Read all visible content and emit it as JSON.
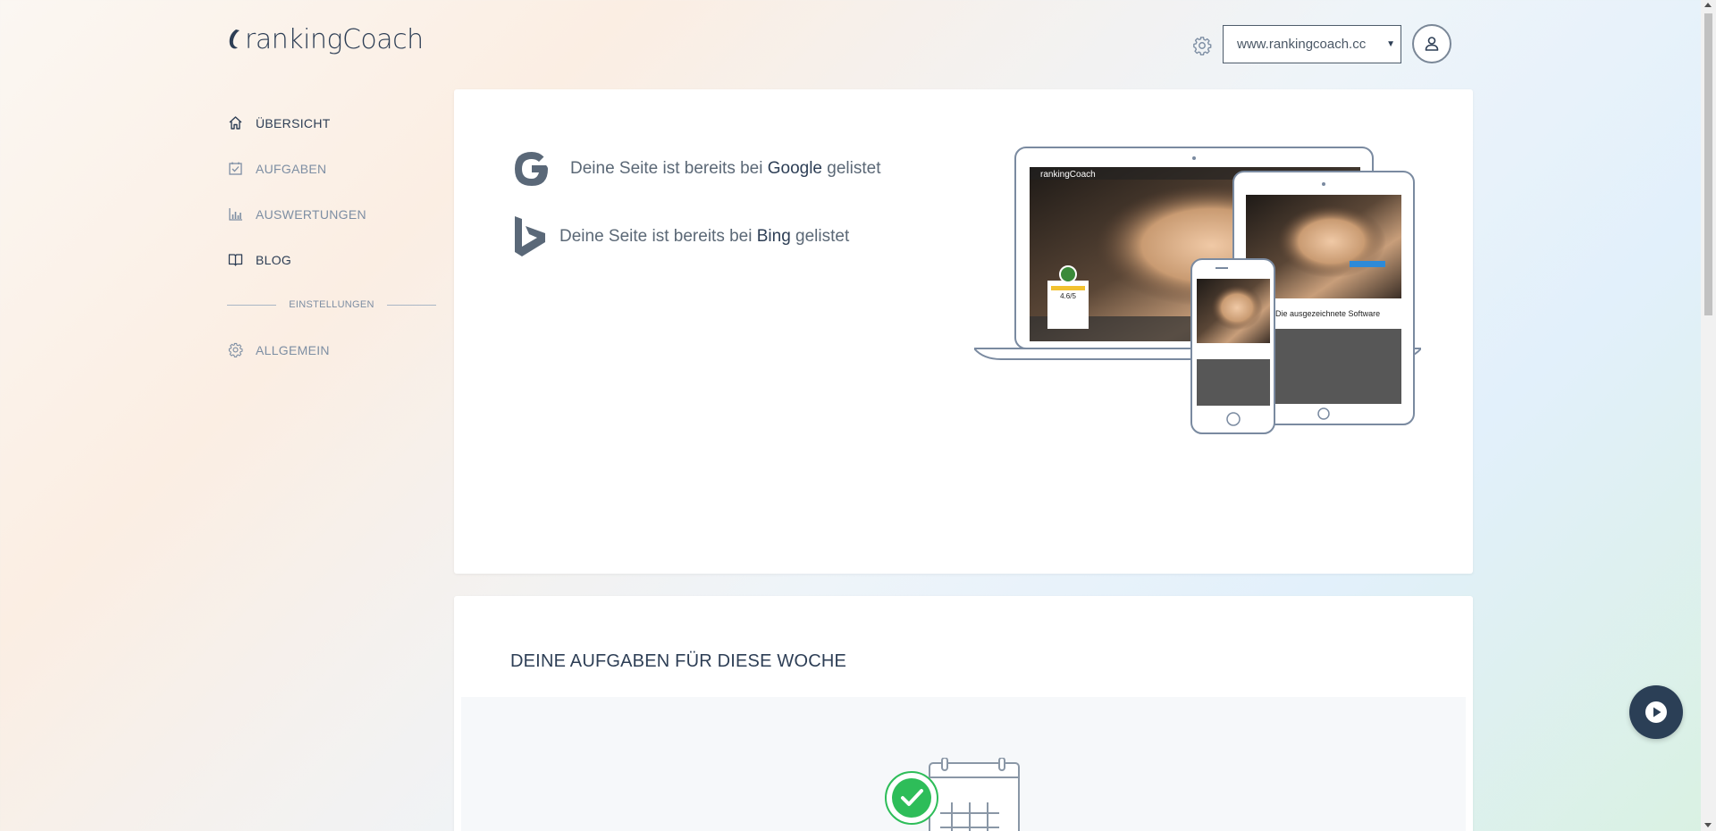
{
  "brand": {
    "name": "rankingCoach",
    "accent": "#2d3e55"
  },
  "sidebar": {
    "items": [
      {
        "label": "ÜBERSICHT",
        "icon": "home-icon"
      },
      {
        "label": "AUFGABEN",
        "icon": "checklist-icon"
      },
      {
        "label": "AUSWERTUNGEN",
        "icon": "bar-chart-icon"
      },
      {
        "label": "BLOG",
        "icon": "book-icon"
      }
    ],
    "section_label": "EINSTELLUNGEN",
    "settings_items": [
      {
        "label": "ALLGEMEIN",
        "icon": "gear-icon"
      }
    ]
  },
  "header": {
    "domain_select": {
      "value": "www.rankingcoach.cc"
    }
  },
  "listings": {
    "google": {
      "prefix": "Deine Seite ist bereits bei",
      "engine": "Google",
      "suffix": "gelistet"
    },
    "bing": {
      "prefix": "Deine Seite ist bereits bei",
      "engine": "Bing",
      "suffix": "gelistet"
    }
  },
  "devices_illustration": {
    "laptop_brand": "rankingCoach",
    "rating": "4.6/5",
    "tablet_heading": "Die ausgezeichnete Software"
  },
  "tasks": {
    "title": "DEINE AUFGABEN FÜR DIESE WOCHE"
  },
  "colors": {
    "success_green": "#2ebd59",
    "fab_bg": "#2b3f56"
  }
}
